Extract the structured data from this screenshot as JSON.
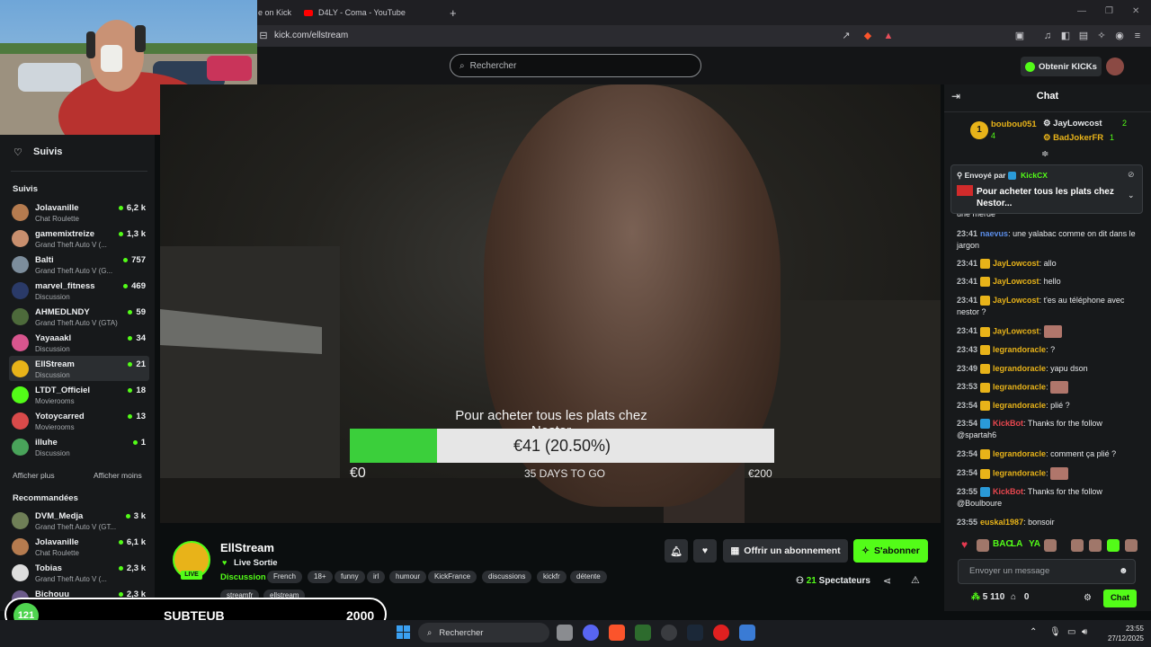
{
  "browser": {
    "tabs": [
      {
        "label": "e on Kick"
      },
      {
        "label": "D4LY - Coma - YouTube"
      }
    ],
    "url": "kick.com/ellstream"
  },
  "header": {
    "search_placeholder": "Rechercher",
    "kicks_button": "Obtenir KICKs"
  },
  "sidebar": {
    "following_title": "Suivis",
    "section_following": "Suivis",
    "following": [
      {
        "name": "Jolavanille",
        "category": "Chat Roulette",
        "viewers": "6,2 k",
        "color": "#b57b4f"
      },
      {
        "name": "gamemixtreize",
        "category": "Grand Theft Auto V (...",
        "viewers": "1,3 k",
        "color": "#c98f6e"
      },
      {
        "name": "Balti",
        "category": "Grand Theft Auto V (G...",
        "viewers": "757",
        "color": "#7c8d9c"
      },
      {
        "name": "marvel_fitness",
        "category": "Discussion",
        "viewers": "469",
        "color": "#2a3a68"
      },
      {
        "name": "AHMEDLNDY",
        "category": "Grand Theft Auto V (GTA)",
        "viewers": "59",
        "color": "#4d6a3b"
      },
      {
        "name": "Yayaaakl",
        "category": "Discussion",
        "viewers": "34",
        "color": "#d8558e"
      },
      {
        "name": "EllStream",
        "category": "Discussion",
        "viewers": "21",
        "color": "#e8b319"
      },
      {
        "name": "LTDT_Officiel",
        "category": "Movierooms",
        "viewers": "18",
        "color": "#53fc18"
      },
      {
        "name": "Yotoycarred",
        "category": "Movierooms",
        "viewers": "13",
        "color": "#d94a4a"
      },
      {
        "name": "illuhe",
        "category": "Discussion",
        "viewers": "1",
        "color": "#49a35a"
      }
    ],
    "show_more": "Afficher plus",
    "show_less": "Afficher moins",
    "section_recommended": "Recommandées",
    "recommended": [
      {
        "name": "DVM_Medja",
        "category": "Grand Theft Auto V (GT...",
        "viewers": "3 k",
        "color": "#6f7f57"
      },
      {
        "name": "Jolavanille",
        "category": "Chat Roulette",
        "viewers": "6,1 k",
        "color": "#b57b4f"
      },
      {
        "name": "Tobias",
        "category": "Grand Theft Auto V (...",
        "viewers": "2,3 k",
        "color": "#ddd"
      },
      {
        "name": "Bichouu",
        "category": "Grand Theft Auto V (...",
        "viewers": "2,3 k",
        "color": "#6b5a8a"
      }
    ]
  },
  "video": {
    "goal_title": "Pour acheter tous les plats chez Nestor",
    "goal_value_label": "€41 (20.50%)",
    "goal_progress": 0.205,
    "goal_start": "€0",
    "goal_days": "35 DAYS TO GO",
    "goal_end": "€200"
  },
  "channel": {
    "live_label": "LIVE",
    "name": "EllStream",
    "title": "Live Sortie",
    "category": "Discussion",
    "tags": [
      "French",
      "18+",
      "funny",
      "irl",
      "humour",
      "KickFrance",
      "discussions",
      "kickfr",
      "détente",
      "streamfr",
      "ellstream"
    ],
    "gift_button": "Offrir un abonnement",
    "subscribe_button": "S'abonner",
    "viewers_count": "21",
    "viewers_label": "Spectateurs"
  },
  "chat": {
    "title": "Chat",
    "leaderboard": [
      {
        "rank": "1",
        "name": "boubou051",
        "count": "4"
      },
      {
        "name": "JayLowcost",
        "count": "2"
      },
      {
        "name": "BadJokerFR",
        "count": "1"
      }
    ],
    "pinned_by_prefix": "Envoyé par",
    "pinned_by_user": "KickCX",
    "pinned_text": "Pour acheter tous les plats chez Nestor...",
    "partial_line": "une merde",
    "messages": [
      {
        "time": "23:41",
        "user": "naevus",
        "color": "#5b8de8",
        "text": "une yalabac comme on dit dans le jargon"
      },
      {
        "time": "23:41",
        "user": "JayLowcost",
        "color": "#e8b319",
        "text": "allo"
      },
      {
        "time": "23:41",
        "user": "JayLowcost",
        "color": "#e8b319",
        "text": "hello"
      },
      {
        "time": "23:41",
        "user": "JayLowcost",
        "color": "#e8b319",
        "text": "t'es au téléphone avec nestor ?"
      },
      {
        "time": "23:41",
        "user": "JayLowcost",
        "color": "#e8b319",
        "text": ""
      },
      {
        "time": "23:43",
        "user": "legrandoracle",
        "color": "#e8b319",
        "text": "?"
      },
      {
        "time": "23:49",
        "user": "legrandoracle",
        "color": "#e8b319",
        "text": "yapu dson"
      },
      {
        "time": "23:53",
        "user": "legrandoracle",
        "color": "#e8b319",
        "text": ""
      },
      {
        "time": "23:54",
        "user": "legrandoracle",
        "color": "#e8b319",
        "text": "plié ?"
      },
      {
        "time": "23:54",
        "user": "KickBot",
        "color": "#e8474f",
        "text": "Thanks for the follow @spartah6"
      },
      {
        "time": "23:54",
        "user": "legrandoracle",
        "color": "#e8b319",
        "text": "comment ça plié ?"
      },
      {
        "time": "23:54",
        "user": "legrandoracle",
        "color": "#e8b319",
        "text": ""
      },
      {
        "time": "23:55",
        "user": "KickBot",
        "color": "#e8474f",
        "text": "Thanks for the follow @Boulboure"
      },
      {
        "time": "23:55",
        "user": "euskal1987",
        "color": "#e8b319",
        "text": "bonsoir"
      }
    ],
    "emote_bar": [
      "BAC",
      "LA",
      "YA"
    ],
    "input_placeholder": "Envoyer un message",
    "kicks_balance": "5 110",
    "store_count": "0",
    "send_button": "Chat"
  },
  "overlay": {
    "sub_count": "121",
    "label": "SUBTEUB",
    "goal": "2000"
  },
  "taskbar": {
    "search": "Rechercher",
    "time": "23:55",
    "date": "27/12/2025"
  }
}
